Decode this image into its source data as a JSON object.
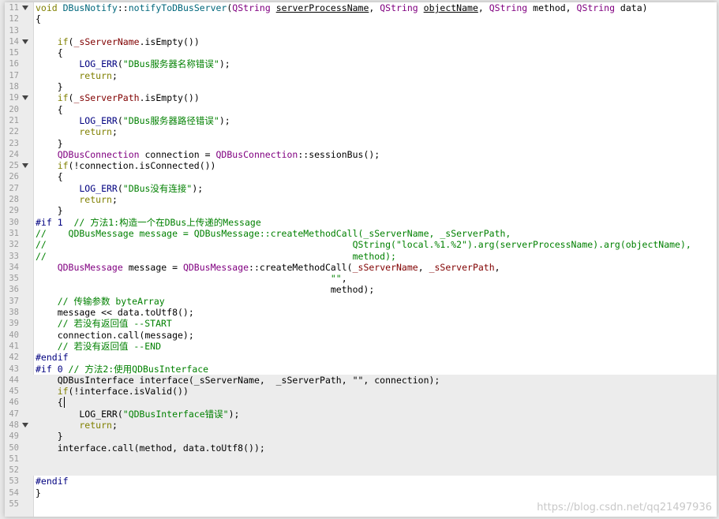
{
  "watermark": "https://blog.csdn.net/qq21497936",
  "lines": [
    {
      "n": "11",
      "fold": true,
      "hl": false,
      "segs": [
        [
          "kw",
          "void "
        ],
        [
          "fn",
          "DBusNotify"
        ],
        [
          "",
          "::"
        ],
        [
          "fn",
          "notifyToDBusServer"
        ],
        [
          "",
          "("
        ],
        [
          "ty",
          "QString "
        ],
        [
          "u",
          "serverProcessName"
        ],
        [
          "",
          ", "
        ],
        [
          "ty",
          "QString "
        ],
        [
          "u",
          "objectName"
        ],
        [
          "",
          ", "
        ],
        [
          "ty",
          "QString "
        ],
        [
          "",
          "method, "
        ],
        [
          "ty",
          "QString "
        ],
        [
          "",
          "data)"
        ]
      ]
    },
    {
      "n": "12",
      "fold": false,
      "hl": false,
      "segs": [
        [
          "",
          "{"
        ]
      ]
    },
    {
      "n": "13",
      "fold": false,
      "hl": false,
      "segs": []
    },
    {
      "n": "14",
      "fold": true,
      "hl": false,
      "segs": [
        [
          "kw",
          "    if"
        ],
        [
          "",
          "("
        ],
        [
          "mbr",
          "_sServerName"
        ],
        [
          "",
          ".isEmpty())"
        ]
      ]
    },
    {
      "n": "15",
      "fold": false,
      "hl": false,
      "segs": [
        [
          "",
          "    {"
        ]
      ]
    },
    {
      "n": "16",
      "fold": false,
      "hl": false,
      "segs": [
        [
          "mac",
          "        LOG_ERR"
        ],
        [
          "",
          "("
        ],
        [
          "st",
          "\"DBus服务器名称错误\""
        ],
        [
          "",
          ");"
        ]
      ]
    },
    {
      "n": "17",
      "fold": false,
      "hl": false,
      "segs": [
        [
          "kw",
          "        return"
        ],
        [
          "",
          ";"
        ]
      ]
    },
    {
      "n": "18",
      "fold": false,
      "hl": false,
      "segs": [
        [
          "",
          "    }"
        ]
      ]
    },
    {
      "n": "19",
      "fold": true,
      "hl": false,
      "segs": [
        [
          "kw",
          "    if"
        ],
        [
          "",
          "("
        ],
        [
          "mbr",
          "_sServerPath"
        ],
        [
          "",
          ".isEmpty())"
        ]
      ]
    },
    {
      "n": "20",
      "fold": false,
      "hl": false,
      "segs": [
        [
          "",
          "    {"
        ]
      ]
    },
    {
      "n": "21",
      "fold": false,
      "hl": false,
      "segs": [
        [
          "mac",
          "        LOG_ERR"
        ],
        [
          "",
          "("
        ],
        [
          "st",
          "\"DBus服务器路径错误\""
        ],
        [
          "",
          ");"
        ]
      ]
    },
    {
      "n": "22",
      "fold": false,
      "hl": false,
      "segs": [
        [
          "kw",
          "        return"
        ],
        [
          "",
          ";"
        ]
      ]
    },
    {
      "n": "23",
      "fold": false,
      "hl": false,
      "segs": [
        [
          "",
          "    }"
        ]
      ]
    },
    {
      "n": "24",
      "fold": false,
      "hl": false,
      "segs": [
        [
          "ty",
          "    QDBusConnection "
        ],
        [
          "",
          "connection = "
        ],
        [
          "ty",
          "QDBusConnection"
        ],
        [
          "",
          "::sessionBus();"
        ]
      ]
    },
    {
      "n": "25",
      "fold": true,
      "hl": false,
      "segs": [
        [
          "kw",
          "    if"
        ],
        [
          "",
          "(!connection.isConnected())"
        ]
      ]
    },
    {
      "n": "26",
      "fold": false,
      "hl": false,
      "segs": [
        [
          "",
          "    {"
        ]
      ]
    },
    {
      "n": "27",
      "fold": false,
      "hl": false,
      "segs": [
        [
          "mac",
          "        LOG_ERR"
        ],
        [
          "",
          "("
        ],
        [
          "st",
          "\"DBus没有连接\""
        ],
        [
          "",
          ");"
        ]
      ]
    },
    {
      "n": "28",
      "fold": false,
      "hl": false,
      "segs": [
        [
          "kw",
          "        return"
        ],
        [
          "",
          ";"
        ]
      ]
    },
    {
      "n": "29",
      "fold": false,
      "hl": false,
      "segs": [
        [
          "",
          "    }"
        ]
      ]
    },
    {
      "n": "30",
      "fold": false,
      "hl": false,
      "segs": [
        [
          "pp",
          "#if 1"
        ],
        [
          "cm",
          "  // 方法1:构造一个在DBus上传递的Message"
        ]
      ]
    },
    {
      "n": "31",
      "fold": false,
      "hl": false,
      "segs": [
        [
          "cm",
          "//    QDBusMessage message = QDBusMessage::createMethodCall(_sServerName, _sServerPath,"
        ]
      ]
    },
    {
      "n": "32",
      "fold": false,
      "hl": false,
      "segs": [
        [
          "cm",
          "//                                                        QString(\"local.%1.%2\").arg(serverProcessName).arg(objectName),"
        ]
      ]
    },
    {
      "n": "33",
      "fold": false,
      "hl": false,
      "segs": [
        [
          "cm",
          "//                                                        method);"
        ]
      ]
    },
    {
      "n": "34",
      "fold": false,
      "hl": false,
      "segs": [
        [
          "ty",
          "    QDBusMessage "
        ],
        [
          "",
          "message = "
        ],
        [
          "ty",
          "QDBusMessage"
        ],
        [
          "",
          "::createMethodCall("
        ],
        [
          "mbr",
          "_sServerName"
        ],
        [
          "",
          ", "
        ],
        [
          "mbr",
          "_sServerPath"
        ],
        [
          "",
          ","
        ]
      ]
    },
    {
      "n": "35",
      "fold": false,
      "hl": false,
      "segs": [
        [
          "st",
          "                                                      \"\""
        ],
        [
          "",
          ","
        ]
      ]
    },
    {
      "n": "36",
      "fold": false,
      "hl": false,
      "segs": [
        [
          "",
          "                                                      method);"
        ]
      ]
    },
    {
      "n": "37",
      "fold": false,
      "hl": false,
      "segs": [
        [
          "cm",
          "    // 传输参数 byteArray"
        ]
      ]
    },
    {
      "n": "38",
      "fold": false,
      "hl": false,
      "segs": [
        [
          "",
          "    message << data.toUtf8();"
        ]
      ]
    },
    {
      "n": "39",
      "fold": false,
      "hl": false,
      "segs": [
        [
          "cm",
          "    // 若没有返回值 --START"
        ]
      ]
    },
    {
      "n": "40",
      "fold": false,
      "hl": false,
      "segs": [
        [
          "",
          "    connection.call(message);"
        ]
      ]
    },
    {
      "n": "41",
      "fold": false,
      "hl": false,
      "segs": [
        [
          "cm",
          "    // 若没有返回值 --END"
        ]
      ]
    },
    {
      "n": "42",
      "fold": false,
      "hl": false,
      "segs": [
        [
          "pp",
          "#endif"
        ]
      ]
    },
    {
      "n": "43",
      "fold": false,
      "hl": false,
      "segs": [
        [
          "pp",
          "#if 0"
        ],
        [
          "cm",
          " // 方法2:使用QDBusInterface"
        ]
      ]
    },
    {
      "n": "44",
      "fold": false,
      "hl": true,
      "segs": [
        [
          "",
          "    QDBusInterface interface(_sServerName,  _sServerPath, \"\", connection);"
        ]
      ]
    },
    {
      "n": "45",
      "fold": false,
      "hl": true,
      "segs": [
        [
          "kw",
          "    if"
        ],
        [
          "",
          "(!interface.isValid())"
        ]
      ]
    },
    {
      "n": "46",
      "fold": false,
      "hl": true,
      "segs": [
        [
          "",
          "    {"
        ],
        [
          "cur",
          ""
        ]
      ]
    },
    {
      "n": "47",
      "fold": false,
      "hl": true,
      "segs": [
        [
          "",
          "        LOG_ERR("
        ],
        [
          "st",
          "\"QDBusInterface错误\""
        ],
        [
          "",
          ");"
        ]
      ]
    },
    {
      "n": "48",
      "fold": true,
      "hl": true,
      "segs": [
        [
          "kw",
          "        return"
        ],
        [
          "",
          ";"
        ]
      ]
    },
    {
      "n": "49",
      "fold": false,
      "hl": true,
      "segs": [
        [
          "",
          "    }"
        ]
      ]
    },
    {
      "n": "50",
      "fold": false,
      "hl": true,
      "segs": [
        [
          "",
          "    interface.call(method, data.toUtf8());"
        ]
      ]
    },
    {
      "n": "51",
      "fold": false,
      "hl": true,
      "segs": []
    },
    {
      "n": "52",
      "fold": false,
      "hl": true,
      "segs": []
    },
    {
      "n": "53",
      "fold": false,
      "hl": false,
      "segs": [
        [
          "pp",
          "#endif"
        ]
      ]
    },
    {
      "n": "54",
      "fold": false,
      "hl": false,
      "segs": [
        [
          "",
          "}"
        ]
      ]
    },
    {
      "n": "55",
      "fold": false,
      "hl": false,
      "segs": []
    }
  ]
}
